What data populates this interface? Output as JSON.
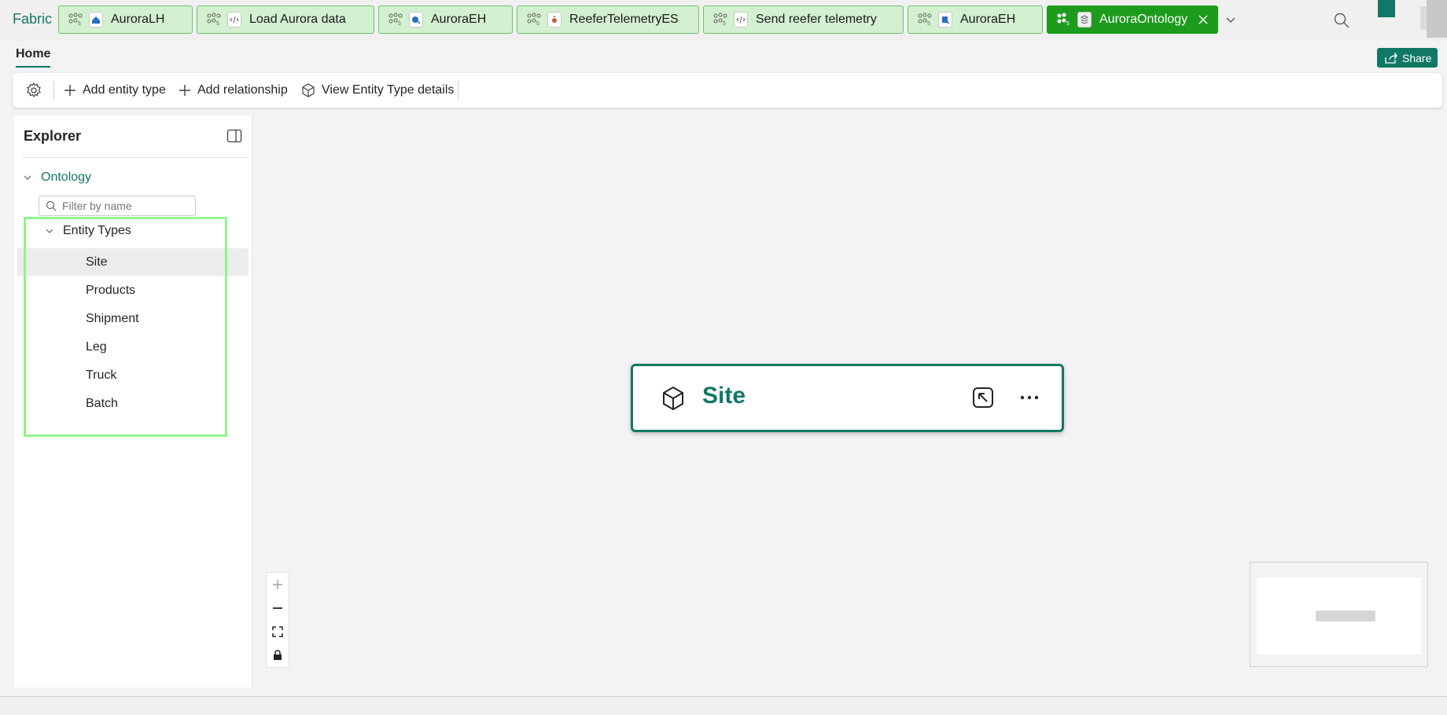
{
  "app": {
    "brand": "Fabric"
  },
  "tabs": [
    {
      "label": "AuroraLH",
      "icon": "lakehouse-icon"
    },
    {
      "label": "Load Aurora data",
      "icon": "notebook-icon"
    },
    {
      "label": "AuroraEH",
      "icon": "eventhouse-icon"
    },
    {
      "label": "ReeferTelemetryES",
      "icon": "eventstream-icon"
    },
    {
      "label": "Send reefer telemetry",
      "icon": "notebook-icon"
    },
    {
      "label": "AuroraEH",
      "icon": "eventhouse-icon"
    },
    {
      "label": "AuroraOntology",
      "icon": "ontology-icon",
      "active": true
    }
  ],
  "ribbon": {
    "home_tab": "Home",
    "share_label": "Share",
    "add_entity_type": "Add entity type",
    "add_relationship": "Add relationship",
    "view_details": "View Entity Type details"
  },
  "explorer": {
    "title": "Explorer",
    "ontology_label": "Ontology",
    "filter_placeholder": "Filter by name",
    "entity_types_label": "Entity Types",
    "items": [
      {
        "label": "Site",
        "selected": true
      },
      {
        "label": "Products"
      },
      {
        "label": "Shipment"
      },
      {
        "label": "Leg"
      },
      {
        "label": "Truck"
      },
      {
        "label": "Batch"
      }
    ]
  },
  "canvas": {
    "node": {
      "title": "Site",
      "icon": "cube-icon"
    }
  },
  "colors": {
    "brand": "#117865",
    "tab_bg": "#d3f0d0",
    "tab_active_bg": "#1d9b1d",
    "highlight": "#8ff58f"
  }
}
